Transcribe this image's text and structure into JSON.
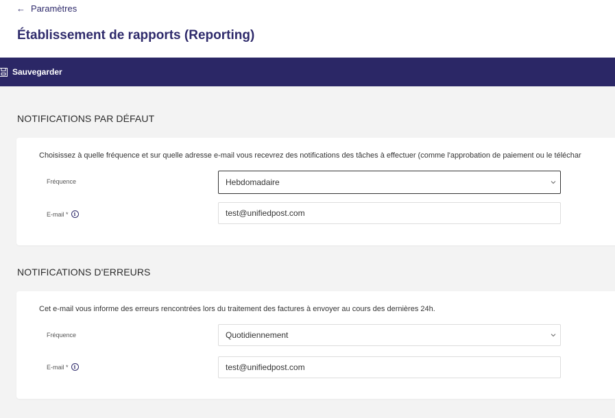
{
  "header": {
    "back_label": "Paramètres",
    "title": "Établissement de rapports (Reporting)"
  },
  "toolbar": {
    "save_label": "Sauvegarder"
  },
  "sections": [
    {
      "title": "NOTIFICATIONS PAR DÉFAUT",
      "description": "Choisissez à quelle fréquence et sur quelle adresse e-mail vous recevrez des notifications des tâches à effectuer (comme l'approbation de paiement ou le téléchar",
      "frequency_label": "Fréquence",
      "frequency_value": "Hebdomadaire",
      "email_label": "E-mail *",
      "email_value": "test@unifiedpost.com"
    },
    {
      "title": "NOTIFICATIONS D'ERREURS",
      "description": "Cet e-mail vous informe des erreurs rencontrées lors du traitement des factures à envoyer au cours des dernières 24h.",
      "frequency_label": "Fréquence",
      "frequency_value": "Quotidiennement",
      "email_label": "E-mail *",
      "email_value": "test@unifiedpost.com"
    }
  ],
  "icons": {
    "back": "arrow-left-icon",
    "save": "save-icon",
    "info": "info-icon",
    "dropdown": "chevron-down-icon"
  },
  "colors": {
    "brand": "#2e2a6b",
    "toolbar_bg": "#2b2766",
    "page_bg": "#f3f3f3"
  }
}
